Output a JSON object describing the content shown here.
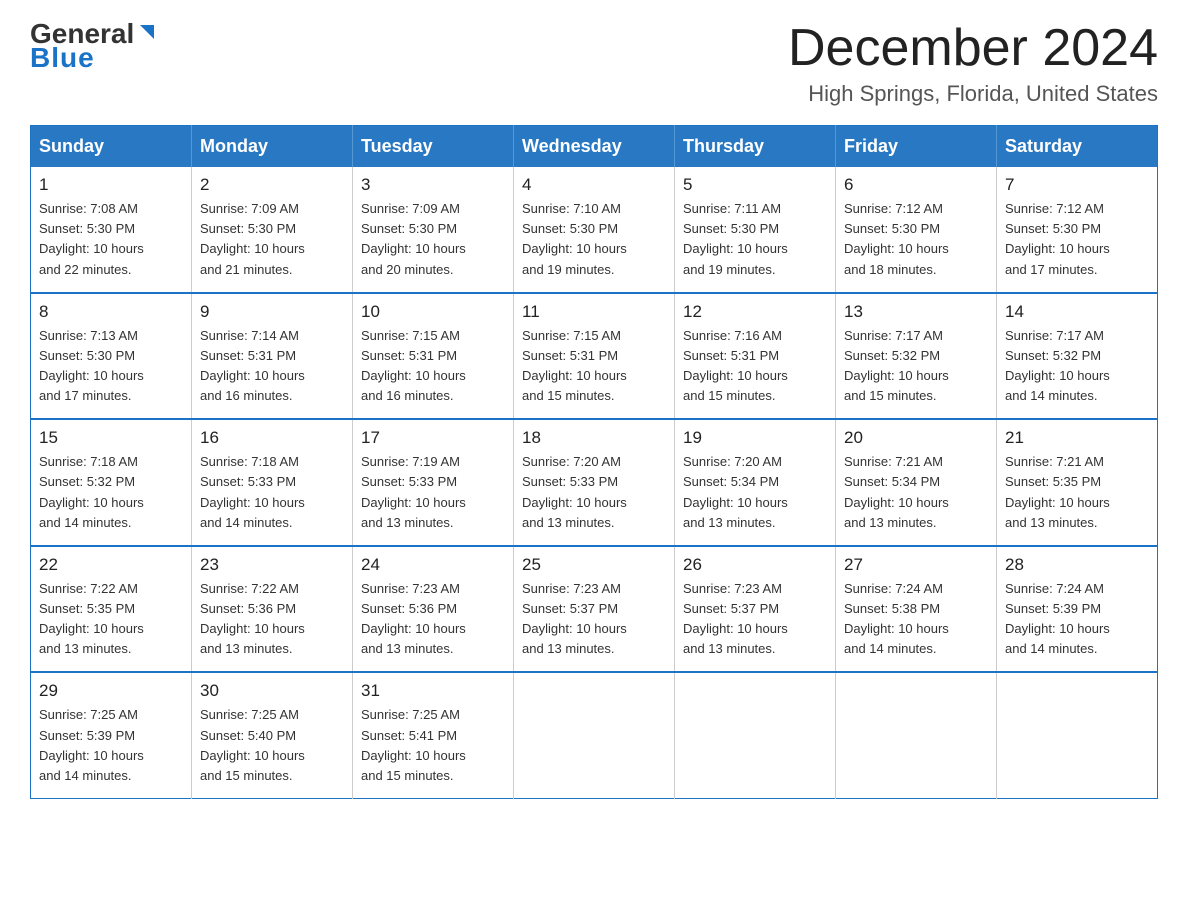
{
  "header": {
    "logo_general": "General",
    "logo_blue": "Blue",
    "title": "December 2024",
    "subtitle": "High Springs, Florida, United States"
  },
  "days_of_week": [
    "Sunday",
    "Monday",
    "Tuesday",
    "Wednesday",
    "Thursday",
    "Friday",
    "Saturday"
  ],
  "weeks": [
    [
      {
        "day": "1",
        "sunrise": "7:08 AM",
        "sunset": "5:30 PM",
        "daylight": "10 hours and 22 minutes."
      },
      {
        "day": "2",
        "sunrise": "7:09 AM",
        "sunset": "5:30 PM",
        "daylight": "10 hours and 21 minutes."
      },
      {
        "day": "3",
        "sunrise": "7:09 AM",
        "sunset": "5:30 PM",
        "daylight": "10 hours and 20 minutes."
      },
      {
        "day": "4",
        "sunrise": "7:10 AM",
        "sunset": "5:30 PM",
        "daylight": "10 hours and 19 minutes."
      },
      {
        "day": "5",
        "sunrise": "7:11 AM",
        "sunset": "5:30 PM",
        "daylight": "10 hours and 19 minutes."
      },
      {
        "day": "6",
        "sunrise": "7:12 AM",
        "sunset": "5:30 PM",
        "daylight": "10 hours and 18 minutes."
      },
      {
        "day": "7",
        "sunrise": "7:12 AM",
        "sunset": "5:30 PM",
        "daylight": "10 hours and 17 minutes."
      }
    ],
    [
      {
        "day": "8",
        "sunrise": "7:13 AM",
        "sunset": "5:30 PM",
        "daylight": "10 hours and 17 minutes."
      },
      {
        "day": "9",
        "sunrise": "7:14 AM",
        "sunset": "5:31 PM",
        "daylight": "10 hours and 16 minutes."
      },
      {
        "day": "10",
        "sunrise": "7:15 AM",
        "sunset": "5:31 PM",
        "daylight": "10 hours and 16 minutes."
      },
      {
        "day": "11",
        "sunrise": "7:15 AM",
        "sunset": "5:31 PM",
        "daylight": "10 hours and 15 minutes."
      },
      {
        "day": "12",
        "sunrise": "7:16 AM",
        "sunset": "5:31 PM",
        "daylight": "10 hours and 15 minutes."
      },
      {
        "day": "13",
        "sunrise": "7:17 AM",
        "sunset": "5:32 PM",
        "daylight": "10 hours and 15 minutes."
      },
      {
        "day": "14",
        "sunrise": "7:17 AM",
        "sunset": "5:32 PM",
        "daylight": "10 hours and 14 minutes."
      }
    ],
    [
      {
        "day": "15",
        "sunrise": "7:18 AM",
        "sunset": "5:32 PM",
        "daylight": "10 hours and 14 minutes."
      },
      {
        "day": "16",
        "sunrise": "7:18 AM",
        "sunset": "5:33 PM",
        "daylight": "10 hours and 14 minutes."
      },
      {
        "day": "17",
        "sunrise": "7:19 AM",
        "sunset": "5:33 PM",
        "daylight": "10 hours and 13 minutes."
      },
      {
        "day": "18",
        "sunrise": "7:20 AM",
        "sunset": "5:33 PM",
        "daylight": "10 hours and 13 minutes."
      },
      {
        "day": "19",
        "sunrise": "7:20 AM",
        "sunset": "5:34 PM",
        "daylight": "10 hours and 13 minutes."
      },
      {
        "day": "20",
        "sunrise": "7:21 AM",
        "sunset": "5:34 PM",
        "daylight": "10 hours and 13 minutes."
      },
      {
        "day": "21",
        "sunrise": "7:21 AM",
        "sunset": "5:35 PM",
        "daylight": "10 hours and 13 minutes."
      }
    ],
    [
      {
        "day": "22",
        "sunrise": "7:22 AM",
        "sunset": "5:35 PM",
        "daylight": "10 hours and 13 minutes."
      },
      {
        "day": "23",
        "sunrise": "7:22 AM",
        "sunset": "5:36 PM",
        "daylight": "10 hours and 13 minutes."
      },
      {
        "day": "24",
        "sunrise": "7:23 AM",
        "sunset": "5:36 PM",
        "daylight": "10 hours and 13 minutes."
      },
      {
        "day": "25",
        "sunrise": "7:23 AM",
        "sunset": "5:37 PM",
        "daylight": "10 hours and 13 minutes."
      },
      {
        "day": "26",
        "sunrise": "7:23 AM",
        "sunset": "5:37 PM",
        "daylight": "10 hours and 13 minutes."
      },
      {
        "day": "27",
        "sunrise": "7:24 AM",
        "sunset": "5:38 PM",
        "daylight": "10 hours and 14 minutes."
      },
      {
        "day": "28",
        "sunrise": "7:24 AM",
        "sunset": "5:39 PM",
        "daylight": "10 hours and 14 minutes."
      }
    ],
    [
      {
        "day": "29",
        "sunrise": "7:25 AM",
        "sunset": "5:39 PM",
        "daylight": "10 hours and 14 minutes."
      },
      {
        "day": "30",
        "sunrise": "7:25 AM",
        "sunset": "5:40 PM",
        "daylight": "10 hours and 15 minutes."
      },
      {
        "day": "31",
        "sunrise": "7:25 AM",
        "sunset": "5:41 PM",
        "daylight": "10 hours and 15 minutes."
      },
      null,
      null,
      null,
      null
    ]
  ],
  "labels": {
    "sunrise": "Sunrise:",
    "sunset": "Sunset:",
    "daylight": "Daylight:"
  }
}
